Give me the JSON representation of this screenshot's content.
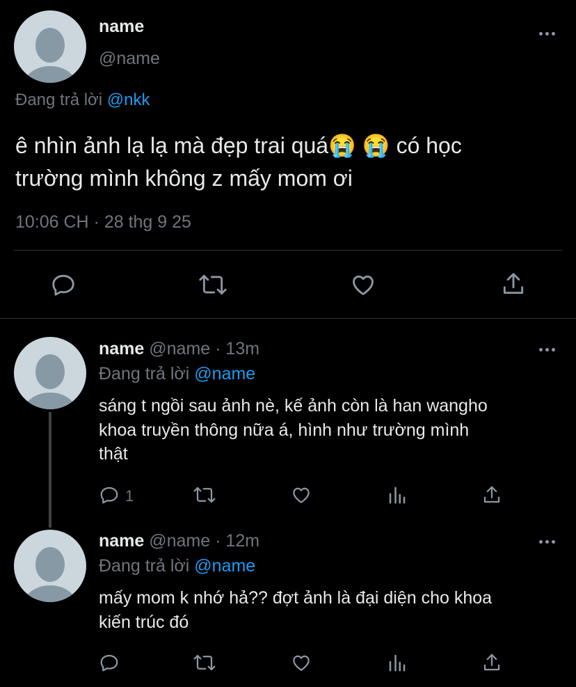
{
  "main_tweet": {
    "name": "name",
    "handle": "@name",
    "replying_prefix": "Đang trả lời",
    "replying_to": "@nkk",
    "text_line1": "ê nhìn ảnh lạ lạ mà đẹp trai quá😭 😭  có học",
    "text_line2": "trường mình không z mấy mom ơi",
    "timestamp": "10:06 CH · 28 thg 9 25"
  },
  "replies": [
    {
      "name": "name",
      "handle": "@name",
      "time": "· 13m",
      "replying_prefix": "Đang trả lời",
      "replying_to": "@name",
      "text_lines": [
        "sáng t ngồi sau ảnh nè, kế ảnh còn là han wangho",
        "khoa truyền thông nữa á, hình như trường mình",
        "thật"
      ],
      "reply_count": "1"
    },
    {
      "name": "name",
      "handle": "@name",
      "time": "· 12m",
      "replying_prefix": "Đang trả lời",
      "replying_to": "@name",
      "text_lines": [
        "mấy mom k nhớ hả?? đợt ảnh là đại diện cho khoa",
        "kiến trúc đó"
      ],
      "reply_count": ""
    }
  ],
  "icons": [
    "reply-icon",
    "retweet-icon",
    "like-icon",
    "share-icon",
    "views-icon",
    "more-icon"
  ],
  "colors": {
    "background": "#000000",
    "text": "#e7e9ea",
    "secondary": "#6e767d",
    "link": "#1d9bf0",
    "avatar": "#ccd6dd"
  }
}
